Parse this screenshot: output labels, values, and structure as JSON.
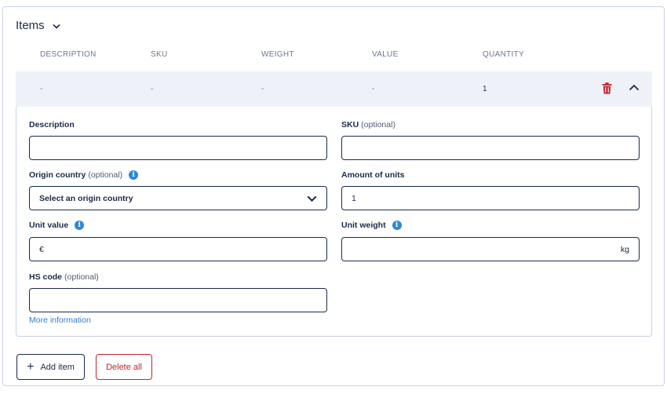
{
  "section": {
    "title": "Items"
  },
  "table": {
    "headers": [
      "DESCRIPTION",
      "SKU",
      "WEIGHT",
      "VALUE",
      "QUANTITY"
    ],
    "row": {
      "description": "-",
      "sku": "-",
      "weight": "-",
      "value": "-",
      "quantity": "1"
    }
  },
  "form": {
    "description": {
      "label": "Description",
      "value": ""
    },
    "sku": {
      "label": "SKU",
      "optional": "(optional)",
      "value": ""
    },
    "origin_country": {
      "label": "Origin country",
      "optional": "(optional)",
      "value": "Select an origin country"
    },
    "amount_of_units": {
      "label": "Amount of units",
      "value": "1"
    },
    "unit_value": {
      "label": "Unit value",
      "prefix": "€",
      "value": ""
    },
    "unit_weight": {
      "label": "Unit weight",
      "suffix": "kg",
      "value": ""
    },
    "hs_code": {
      "label": "HS code",
      "optional": "(optional)",
      "value": ""
    },
    "more_info_link": "More information"
  },
  "buttons": {
    "add_item": "Add item",
    "delete_all": "Delete all"
  },
  "colors": {
    "text_primary": "#1b2a4a",
    "muted": "#6b7891",
    "row_background": "#eef2f8",
    "info_blue": "#2d88d8",
    "danger_red": "#c0262c"
  }
}
